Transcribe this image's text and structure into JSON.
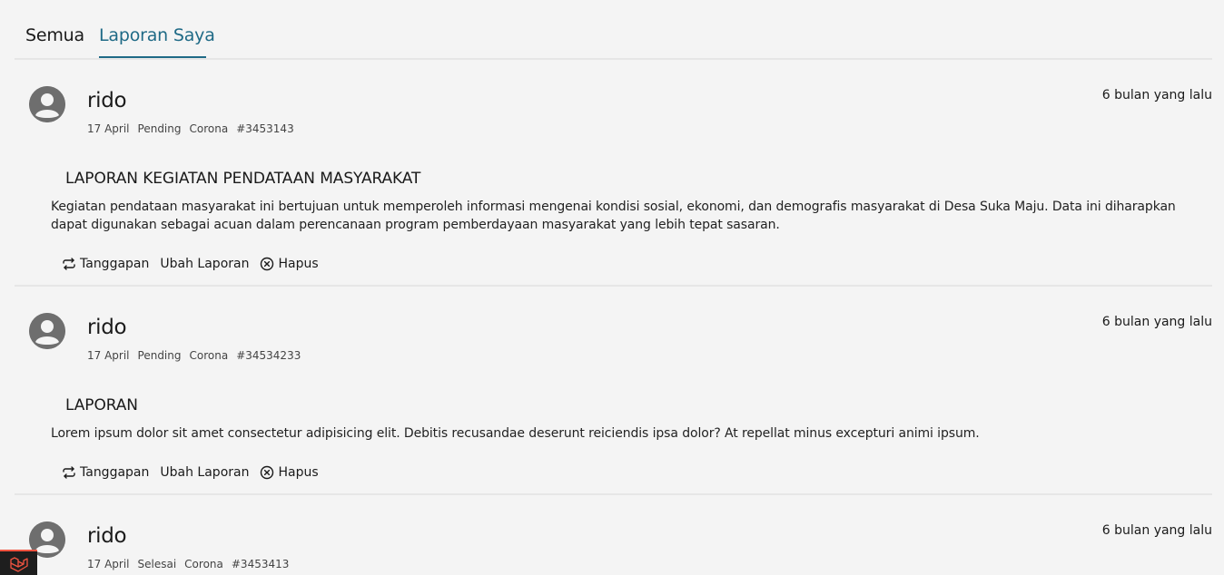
{
  "tabs": [
    {
      "label": "Semua",
      "active": false
    },
    {
      "label": "Laporan Saya",
      "active": true
    }
  ],
  "colors": {
    "accent": "#1f6a86",
    "background": "#f4f4f4",
    "avatar": "#6e6e6e",
    "divider": "#e6e6e6",
    "corner_badge": "#f05340"
  },
  "reports": [
    {
      "user": "rido",
      "date": "17 April",
      "status": "Pending",
      "category": "Corona",
      "code": "#3453143",
      "time": "6 bulan yang lalu",
      "title": "LAPORAN KEGIATAN PENDATAAN MASYARAKAT",
      "body": "Kegiatan pendataan masyarakat ini bertujuan untuk memperoleh informasi mengenai kondisi sosial, ekonomi, dan demografis masyarakat di Desa Suka Maju. Data ini diharapkan dapat digunakan sebagai acuan dalam perencanaan program pemberdayaan masyarakat yang lebih tepat sasaran.",
      "actions": {
        "respond": "Tanggapan",
        "edit": "Ubah Laporan",
        "delete": "Hapus"
      }
    },
    {
      "user": "rido",
      "date": "17 April",
      "status": "Pending",
      "category": "Corona",
      "code": "#34534233",
      "time": "6 bulan yang lalu",
      "title": "LAPORAN",
      "body": "Lorem ipsum dolor sit amet consectetur adipisicing elit. Debitis recusandae deserunt reiciendis ipsa dolor? At repellat minus excepturi animi ipsum.",
      "actions": {
        "respond": "Tanggapan",
        "edit": "Ubah Laporan",
        "delete": "Hapus"
      }
    },
    {
      "user": "rido",
      "date": "17 April",
      "status": "Selesai",
      "category": "Corona",
      "code": "#3453413",
      "time": "6 bulan yang lalu",
      "title": "",
      "body": "",
      "actions": {
        "respond": "",
        "edit": "",
        "delete": ""
      }
    }
  ],
  "icons": {
    "avatar": "user-avatar-icon",
    "respond": "repeat-icon",
    "delete": "x-circle-icon",
    "corner": "laravel-logo-icon"
  }
}
